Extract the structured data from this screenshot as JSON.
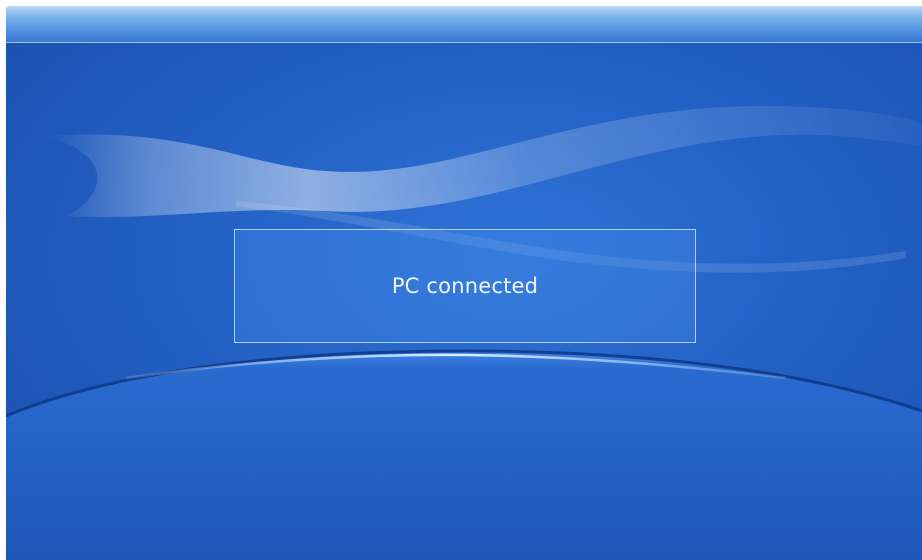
{
  "dialog": {
    "message": "PC connected"
  },
  "colors": {
    "background": "#2260c4",
    "top_bar": "#7cb3ec",
    "dialog_border": "#c8e1ff",
    "text": "#eef5ff"
  }
}
